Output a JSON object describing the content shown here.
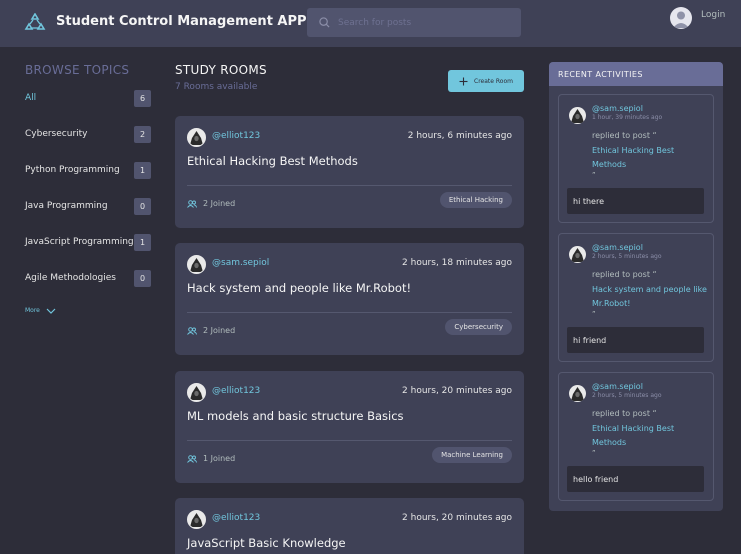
{
  "header": {
    "app_title": "Student Control Management APP",
    "search_placeholder": "Search for posts",
    "login_label": "Login"
  },
  "sidebar": {
    "title": "BROWSE TOPICS",
    "topics": [
      {
        "label": "All",
        "count": "6"
      },
      {
        "label": "Cybersecurity",
        "count": "2"
      },
      {
        "label": "Python Programming",
        "count": "1"
      },
      {
        "label": "Java Programming",
        "count": "0"
      },
      {
        "label": "JavaScript Programming",
        "count": "1"
      },
      {
        "label": "Agile Methodologies",
        "count": "0"
      }
    ],
    "more_label": "More"
  },
  "rooms": {
    "title": "STUDY ROOMS",
    "subtitle": "7 Rooms available",
    "create_label": "Create Room",
    "cards": [
      {
        "user": "@elliot123",
        "time": "2 hours, 6 minutes ago",
        "title": "Ethical Hacking Best Methods",
        "joined": "2 Joined",
        "tag": "Ethical Hacking"
      },
      {
        "user": "@sam.sepiol",
        "time": "2 hours, 18 minutes ago",
        "title": "Hack system and people like Mr.Robot!",
        "joined": "2 Joined",
        "tag": "Cybersecurity"
      },
      {
        "user": "@elliot123",
        "time": "2 hours, 20 minutes ago",
        "title": "ML models and basic structure Basics",
        "joined": "1 Joined",
        "tag": "Machine Learning"
      },
      {
        "user": "@elliot123",
        "time": "2 hours, 20 minutes ago",
        "title": "JavaScript Basic Knowledge",
        "joined": "",
        "tag": ""
      }
    ]
  },
  "recent": {
    "title": "RECENT ACTIVITIES",
    "items": [
      {
        "user": "@sam.sepiol",
        "time": "1 hour, 39 minutes ago",
        "replied": "replied to post “",
        "post": "Ethical Hacking Best Methods",
        "quote_close": "”",
        "message": "hi there"
      },
      {
        "user": "@sam.sepiol",
        "time": "2 hours, 5 minutes ago",
        "replied": "replied to post “",
        "post": "Hack system and people like Mr.Robot!",
        "quote_close": "”",
        "message": "hi friend"
      },
      {
        "user": "@sam.sepiol",
        "time": "2 hours, 5 minutes ago",
        "replied": "replied to post “",
        "post": "Ethical Hacking Best Methods",
        "quote_close": "”",
        "message": "hello friend"
      }
    ]
  },
  "colors": {
    "background": "#2d2d39",
    "panel": "#3f4156",
    "accent": "#71c6dd",
    "muted": "#696d97"
  }
}
